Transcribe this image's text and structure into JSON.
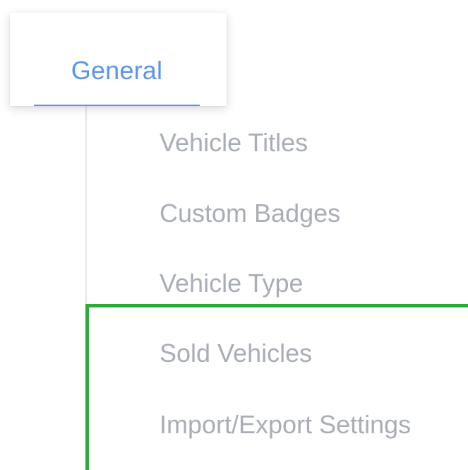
{
  "tabs": {
    "active_label": "General",
    "accent_color": "#5b95ea"
  },
  "submenu": {
    "items": [
      {
        "label": "Vehicle Titles"
      },
      {
        "label": "Custom Badges"
      },
      {
        "label": "Vehicle Type"
      },
      {
        "label": "Sold Vehicles"
      },
      {
        "label": "Import/Export Settings"
      }
    ],
    "text_color": "#a9adb5"
  },
  "highlight": {
    "color": "#2eaa3a"
  }
}
